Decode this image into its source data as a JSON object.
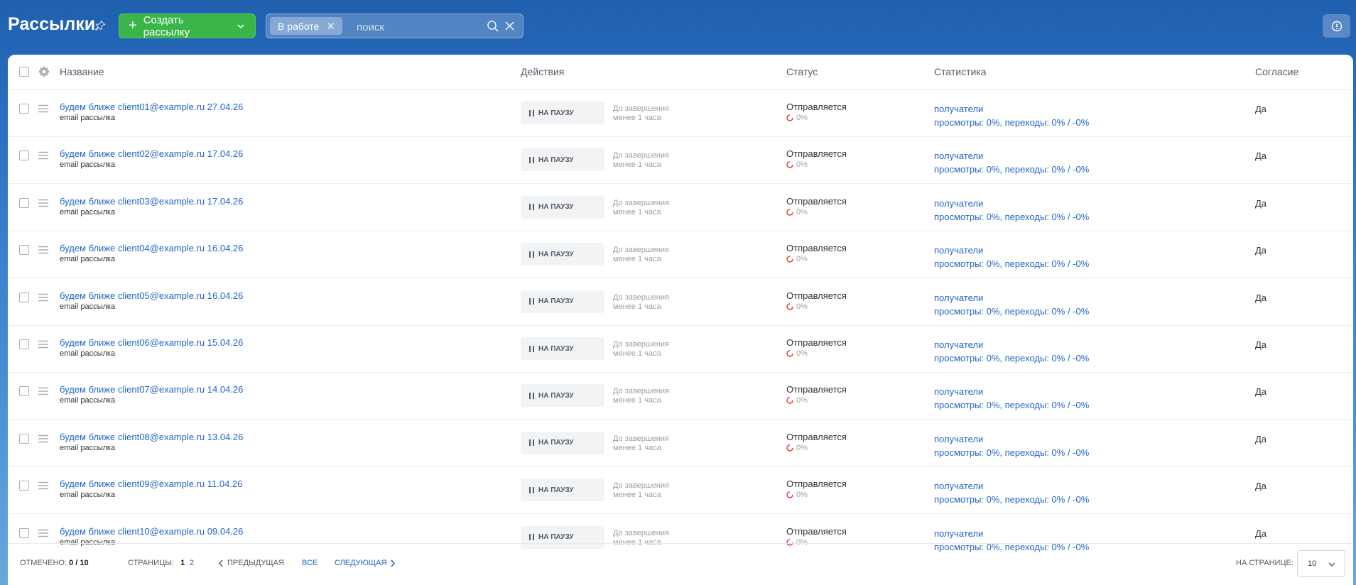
{
  "header": {
    "title": "Рассылки",
    "create_label": "Создать рассылку",
    "filter_chip": "В работе",
    "search_placeholder": "поиск"
  },
  "table": {
    "columns": {
      "name": "Название",
      "actions": "Действия",
      "status": "Статус",
      "stats": "Статистика",
      "consent": "Согласие"
    },
    "rows": [
      {
        "title": "будем ближе client01@example.ru 27.04.26",
        "type": "email рассылка",
        "action": "НА ПАУЗУ",
        "due_label": "До завершения",
        "due_value": "менее 1 часа",
        "status": "Отправляется",
        "progress": "0%",
        "stat_recipients": "получатели",
        "stat_summary": "просмотры: 0%, переходы: 0% / -0%",
        "consent": "Да"
      },
      {
        "title": "будем ближе client02@example.ru 17.04.26",
        "type": "email рассылка",
        "action": "НА ПАУЗУ",
        "due_label": "До завершения",
        "due_value": "менее 1 часа",
        "status": "Отправляется",
        "progress": "0%",
        "stat_recipients": "получатели",
        "stat_summary": "просмотры: 0%, переходы: 0% / -0%",
        "consent": "Да"
      },
      {
        "title": "будем ближе client03@example.ru 17.04.26",
        "type": "email рассылка",
        "action": "НА ПАУЗУ",
        "due_label": "До завершения",
        "due_value": "менее 1 часа",
        "status": "Отправляется",
        "progress": "0%",
        "stat_recipients": "получатели",
        "stat_summary": "просмотры: 0%, переходы: 0% / -0%",
        "consent": "Да"
      },
      {
        "title": "будем ближе client04@example.ru 16.04.26",
        "type": "email рассылка",
        "action": "НА ПАУЗУ",
        "due_label": "До завершения",
        "due_value": "менее 1 часа",
        "status": "Отправляется",
        "progress": "0%",
        "stat_recipients": "получатели",
        "stat_summary": "просмотры: 0%, переходы: 0% / -0%",
        "consent": "Да"
      },
      {
        "title": "будем ближе client05@example.ru 16.04.26",
        "type": "email рассылка",
        "action": "НА ПАУЗУ",
        "due_label": "До завершения",
        "due_value": "менее 1 часа",
        "status": "Отправляется",
        "progress": "0%",
        "stat_recipients": "получатели",
        "stat_summary": "просмотры: 0%, переходы: 0% / -0%",
        "consent": "Да"
      },
      {
        "title": "будем ближе client06@example.ru 15.04.26",
        "type": "email рассылка",
        "action": "НА ПАУЗУ",
        "due_label": "До завершения",
        "due_value": "менее 1 часа",
        "status": "Отправляется",
        "progress": "0%",
        "stat_recipients": "получатели",
        "stat_summary": "просмотры: 0%, переходы: 0% / -0%",
        "consent": "Да"
      },
      {
        "title": "будем ближе client07@example.ru 14.04.26",
        "type": "email рассылка",
        "action": "НА ПАУЗУ",
        "due_label": "До завершения",
        "due_value": "менее 1 часа",
        "status": "Отправляется",
        "progress": "0%",
        "stat_recipients": "получатели",
        "stat_summary": "просмотры: 0%, переходы: 0% / -0%",
        "consent": "Да"
      },
      {
        "title": "будем ближе client08@example.ru 13.04.26",
        "type": "email рассылка",
        "action": "НА ПАУЗУ",
        "due_label": "До завершения",
        "due_value": "менее 1 часа",
        "status": "Отправляется",
        "progress": "0%",
        "stat_recipients": "получатели",
        "stat_summary": "просмотры: 0%, переходы: 0% / -0%",
        "consent": "Да"
      },
      {
        "title": "будем ближе client09@example.ru 11.04.26",
        "type": "email рассылка",
        "action": "НА ПАУЗУ",
        "due_label": "До завершения",
        "due_value": "менее 1 часа",
        "status": "Отправляется",
        "progress": "0%",
        "stat_recipients": "получатели",
        "stat_summary": "просмотры: 0%, переходы: 0% / -0%",
        "consent": "Да"
      },
      {
        "title": "будем ближе client10@example.ru 09.04.26",
        "type": "email рассылка",
        "action": "НА ПАУЗУ",
        "due_label": "До завершения",
        "due_value": "менее 1 часа",
        "status": "Отправляется",
        "progress": "0%",
        "stat_recipients": "получатели",
        "stat_summary": "просмотры: 0%, переходы: 0% / -0%",
        "consent": "Да"
      }
    ]
  },
  "footer": {
    "selected_label": "ОТМЕЧЕНО:",
    "selected_value": "0 / 10",
    "pages_label": "СТРАНИЦЫ:",
    "page_current": "1",
    "page_next": "2",
    "prev_label": "ПРЕДЫДУЩАЯ",
    "all_label": "ВСЕ",
    "next_label": "СЛЕДУЮЩАЯ",
    "per_page_label": "НА СТРАНИЦЕ:",
    "per_page_value": "10"
  },
  "colors": {
    "accent": "#1f66c4",
    "create_button": "#3bb54a",
    "spinner": "#e0443a"
  }
}
